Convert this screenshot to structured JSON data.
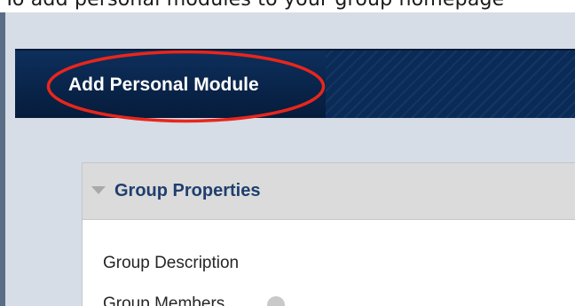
{
  "annotation": {
    "caption": "To add personal modules to your group homepage",
    "highlight_color": "#e8261c"
  },
  "toolbar": {
    "add_module_label": "Add Personal Module",
    "background_color": "#0a2b57"
  },
  "panel": {
    "title": "Group Properties",
    "title_color": "#1f3f6e",
    "fields": [
      {
        "label": "Group Description"
      },
      {
        "label": "Group Members"
      }
    ]
  },
  "icons": {
    "collapse": "triangle-down-icon",
    "help": "help-icon"
  }
}
